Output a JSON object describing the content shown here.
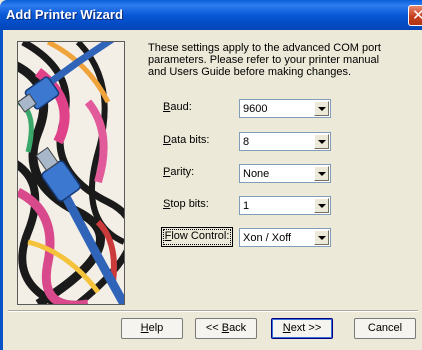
{
  "window": {
    "title": "Add Printer Wizard",
    "close_glyph": "✕"
  },
  "description": "These settings apply to the advanced COM port parameters.  Please refer to your printer manual and Users Guide before making changes.",
  "fields": {
    "baud": {
      "label_pre": "",
      "label_key": "B",
      "label_post": "aud:",
      "value": "9600"
    },
    "data_bits": {
      "label_pre": "",
      "label_key": "D",
      "label_post": "ata bits:",
      "value": "8"
    },
    "parity": {
      "label_pre": "",
      "label_key": "P",
      "label_post": "arity:",
      "value": "None"
    },
    "stop_bits": {
      "label_pre": "",
      "label_key": "S",
      "label_post": "top bits:",
      "value": "1"
    },
    "flow_control": {
      "label_pre": "",
      "label_key": "F",
      "label_post": "low Control:",
      "value": "Xon / Xoff"
    }
  },
  "buttons": {
    "help": {
      "key": "H",
      "rest": "elp"
    },
    "back": {
      "pre": "<< ",
      "key": "B",
      "rest": "ack"
    },
    "next": {
      "key": "N",
      "rest": "ext >>"
    },
    "cancel": "Cancel"
  },
  "colors": {
    "titlebar": "#0858d6",
    "dialog_bg": "#ece9d8",
    "close_button": "#c7401e"
  }
}
